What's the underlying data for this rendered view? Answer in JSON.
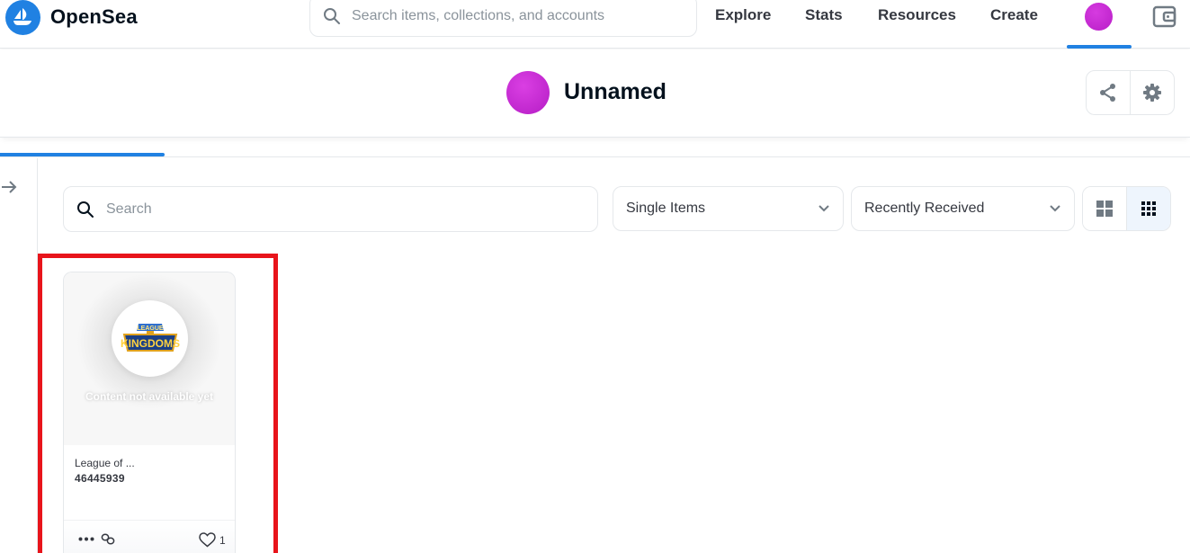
{
  "nav": {
    "brand": "OpenSea",
    "search_placeholder": "Search items, collections, and accounts",
    "links": [
      "Explore",
      "Stats",
      "Resources",
      "Create"
    ]
  },
  "profile": {
    "name": "Unnamed"
  },
  "filters": {
    "search_placeholder": "Search",
    "type_selected": "Single Items",
    "sort_selected": "Recently Received"
  },
  "items": [
    {
      "media_text": "Content not available yet",
      "collection": "League of ...",
      "token": "46445939",
      "likes": "1",
      "logo_text": "LEAGUE of KINGDOMS"
    }
  ],
  "colors": {
    "accent": "#2081e2",
    "avatar": "#c52ad3",
    "highlight": "#e8141b"
  }
}
